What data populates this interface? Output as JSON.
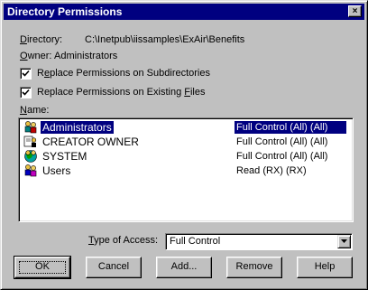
{
  "window": {
    "title": "Directory Permissions",
    "close_glyph": "×"
  },
  "directory": {
    "label": "Directory:",
    "value": "C:\\Inetpub\\iissamples\\ExAir\\Benefits"
  },
  "owner": {
    "label": "Owner:",
    "value": "Administrators"
  },
  "options": {
    "replace_subdirs": {
      "label": "Replace Permissions on Subdirectories",
      "checked": true
    },
    "replace_files": {
      "label": "Replace Permissions on Existing Files",
      "checked": true
    }
  },
  "names_label": "Name:",
  "permissions": [
    {
      "name": "Administrators",
      "access": "Full Control (All) (All)",
      "icon": "group-icon",
      "selected": true
    },
    {
      "name": "CREATOR OWNER",
      "access": "Full Control (All) (All)",
      "icon": "creator-owner-icon",
      "selected": false
    },
    {
      "name": "SYSTEM",
      "access": "Full Control (All) (All)",
      "icon": "system-group-icon",
      "selected": false
    },
    {
      "name": "Users",
      "access": "Read (RX) (RX)",
      "icon": "users-group-icon",
      "selected": false
    }
  ],
  "type_of_access": {
    "label": "Type of Access:",
    "value": "Full Control"
  },
  "buttons": {
    "ok": "OK",
    "cancel": "Cancel",
    "add": "Add...",
    "remove": "Remove",
    "help": "Help"
  },
  "colors": {
    "face": "#c0c0c0",
    "title_bar": "#000080",
    "selection": "#000080"
  }
}
